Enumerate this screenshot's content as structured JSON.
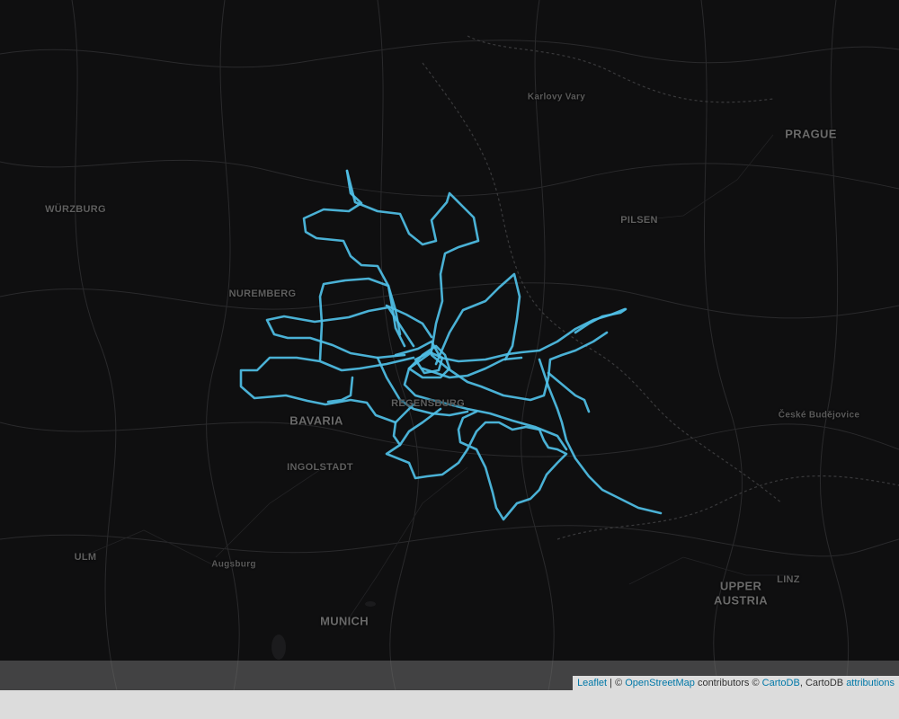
{
  "map": {
    "theme_colors": {
      "background": "#0f0f10",
      "track": "#4fbfe6",
      "label": "#5f5f5f"
    },
    "labels": [
      {
        "id": "karlovy-vary",
        "text": "Karlovy Vary",
        "size": "small"
      },
      {
        "id": "prague",
        "text": "PRAGUE",
        "size": "big"
      },
      {
        "id": "wurzburg",
        "text": "WÜRZBURG",
        "size": "med"
      },
      {
        "id": "pilsen",
        "text": "PILSEN",
        "size": "med"
      },
      {
        "id": "nuremberg",
        "text": "NUREMBERG",
        "size": "med"
      },
      {
        "id": "bavaria",
        "text": "BAVARIA",
        "size": "big"
      },
      {
        "id": "regensburg",
        "text": "REGENSBURG",
        "size": "med"
      },
      {
        "id": "ceske-budejovice",
        "text": "České Budějovice",
        "size": "small"
      },
      {
        "id": "ingolstadt",
        "text": "INGOLSTADT",
        "size": "med"
      },
      {
        "id": "ulm",
        "text": "ULM",
        "size": "med"
      },
      {
        "id": "augsburg",
        "text": "Augsburg",
        "size": "small"
      },
      {
        "id": "upper-austria-1",
        "text": "UPPER",
        "size": "big"
      },
      {
        "id": "upper-austria-2",
        "text": "AUSTRIA",
        "size": "big"
      },
      {
        "id": "linz",
        "text": "LINZ",
        "size": "med"
      },
      {
        "id": "munich",
        "text": "MUNICH",
        "size": "big"
      }
    ]
  },
  "attribution": {
    "leaflet": "Leaflet",
    "sep1": " | © ",
    "osm": "OpenStreetMap",
    "contrib": " contributors © ",
    "cartodb": "CartoDB",
    "sep2": ", CartoDB ",
    "attributions": "attributions"
  }
}
